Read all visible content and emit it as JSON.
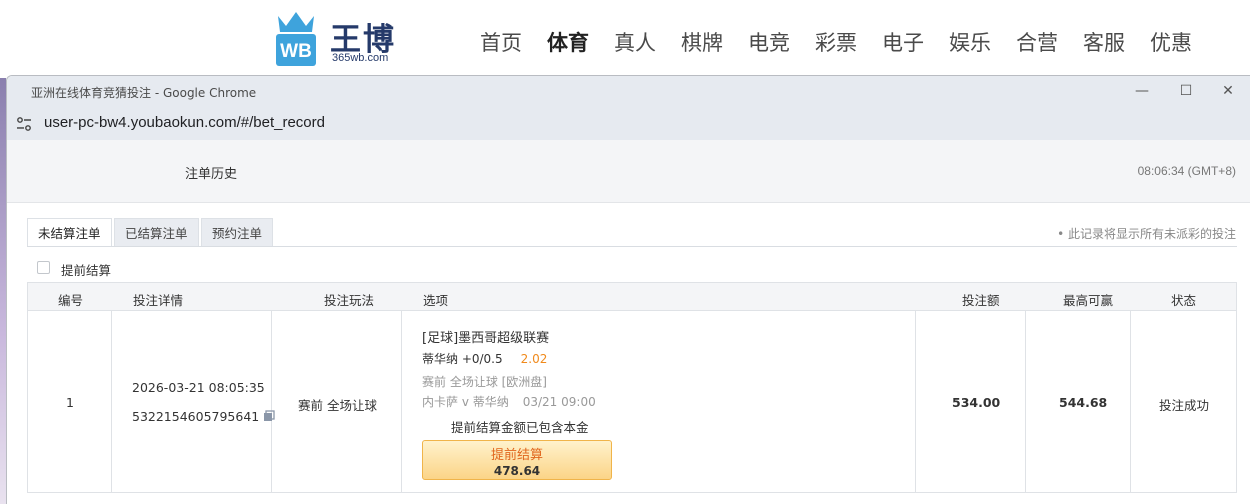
{
  "site": {
    "logo_text": "王博",
    "logo_mark": "WB",
    "logo_domain": "365wb.com",
    "nav": [
      "首页",
      "体育",
      "真人",
      "棋牌",
      "电竞",
      "彩票",
      "电子",
      "娱乐",
      "合营",
      "客服",
      "优惠"
    ],
    "active_nav": "体育"
  },
  "browser": {
    "title": "亚洲在线体育竞猜投注 - Google Chrome",
    "url": "user-pc-bw4.youbaokun.com/#/bet_record"
  },
  "page": {
    "title": "注单历史",
    "clock": "08:06:34 (GMT+8)",
    "tabs": [
      "未结算注单",
      "已结算注单",
      "预约注单"
    ],
    "active_tab": "未结算注单",
    "note": "• 此记录将显示所有未派彩的投注",
    "early_settle_label": "提前结算"
  },
  "table": {
    "headers": {
      "no": "编号",
      "details": "投注详情",
      "play": "投注玩法",
      "selection": "选项",
      "stake": "投注额",
      "max_win": "最高可赢",
      "status": "状态"
    },
    "row": {
      "no": "1",
      "datetime": "2026-03-21 08:05:35",
      "bet_id": "5322154605795641",
      "play": "赛前 全场让球",
      "league": "[足球]墨西哥超级联赛",
      "pick": "蒂华纳 +0/0.5",
      "odds": "2.02",
      "market": "赛前   全场让球   [欧洲盘]",
      "match": "内卡萨 v 蒂华纳",
      "match_time": "03/21 09:00",
      "early_note": "提前结算金额已包含本金",
      "early_button_label": "提前结算",
      "early_amount": "478.64",
      "stake": "534.00",
      "max_win": "544.68",
      "status": "投注成功"
    }
  }
}
